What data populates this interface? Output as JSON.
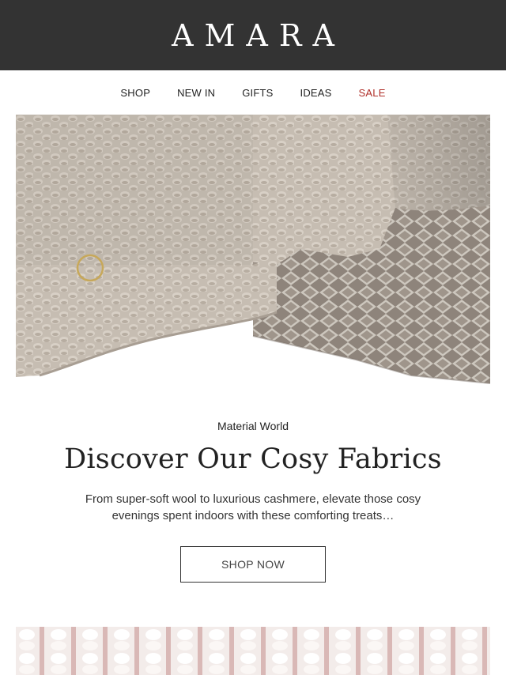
{
  "brand": {
    "name": "AMARA"
  },
  "nav": {
    "items": [
      {
        "label": "SHOP"
      },
      {
        "label": "NEW IN"
      },
      {
        "label": "GIFTS"
      },
      {
        "label": "IDEAS"
      },
      {
        "label": "SALE"
      }
    ]
  },
  "colors": {
    "header_bg": "#333333",
    "sale": "#b0302a",
    "knit": "#c2b9ae"
  },
  "promo": {
    "eyebrow": "Material World",
    "headline": "Discover Our Cosy Fabrics",
    "body": "From super-soft wool to luxurious cashmere, elevate those cosy evenings spent indoors with these comforting treats…",
    "cta": "SHOP NOW"
  }
}
